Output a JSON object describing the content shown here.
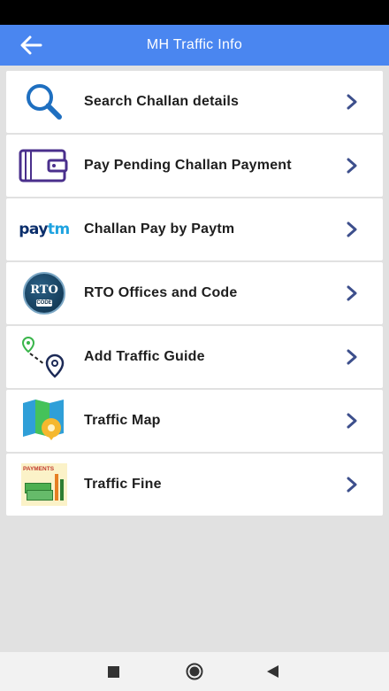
{
  "app_bar": {
    "title": "MH Traffic Info",
    "back_icon": "arrow-left-icon"
  },
  "menu": [
    {
      "label": "Search Challan details",
      "icon": "search-icon"
    },
    {
      "label": "Pay Pending Challan Payment",
      "icon": "wallet-icon"
    },
    {
      "label": "Challan Pay by Paytm",
      "icon": "paytm-logo"
    },
    {
      "label": "RTO Offices and Code",
      "icon": "rto-badge-icon",
      "icon_text": "RTO",
      "icon_subtext": "CODE"
    },
    {
      "label": "Add Traffic Guide",
      "icon": "route-pin-icon"
    },
    {
      "label": "Traffic Map",
      "icon": "map-icon"
    },
    {
      "label": "Traffic Fine",
      "icon": "payments-icon",
      "icon_text": "PAYMENTS"
    }
  ],
  "paytm_logo_text": {
    "pay": "pay",
    "tm": "tm"
  },
  "nav_bar": {
    "buttons": [
      "recents-square-icon",
      "home-circle-icon",
      "back-triangle-icon"
    ]
  },
  "colors": {
    "app_bar": "#4a86f0",
    "background": "#e1e1e1",
    "chevron": "#3d4f8c"
  }
}
